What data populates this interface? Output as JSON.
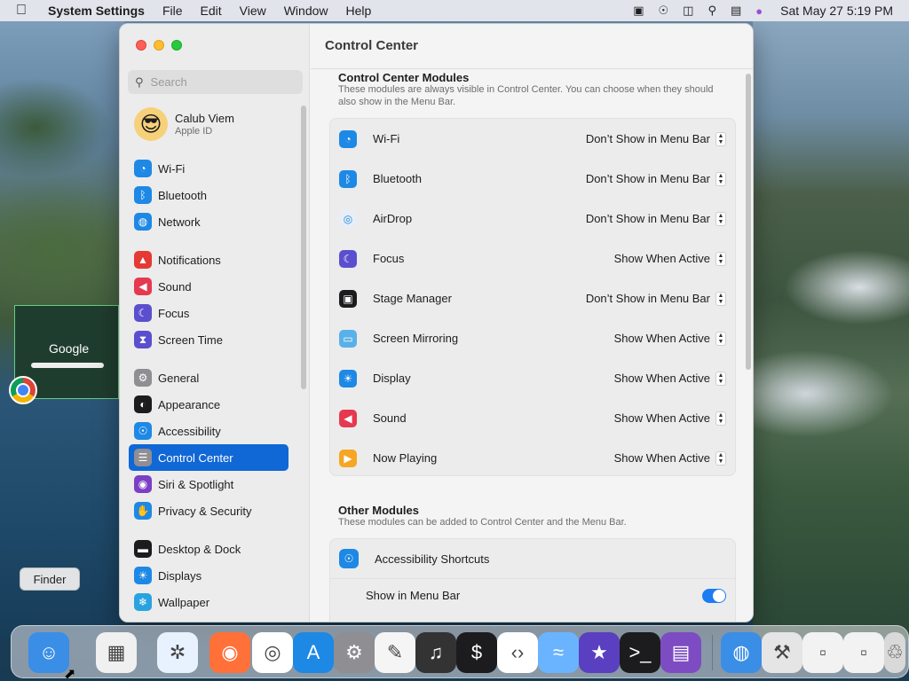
{
  "menubar": {
    "app_name": "System Settings",
    "items": [
      "File",
      "Edit",
      "View",
      "Window",
      "Help"
    ],
    "clock": "Sat May 27  5:19 PM"
  },
  "window": {
    "title": "Control Center",
    "search": {
      "placeholder": "Search",
      "value": ""
    },
    "user": {
      "name": "Calub Viem",
      "subtitle": "Apple ID"
    },
    "sidebar": {
      "groups": [
        [
          {
            "label": "Wi-Fi",
            "icon": "wifi-icon",
            "color": "#1e88e5"
          },
          {
            "label": "Bluetooth",
            "icon": "bluetooth-icon",
            "color": "#1e88e5"
          },
          {
            "label": "Network",
            "icon": "globe-icon",
            "color": "#1e88e5"
          }
        ],
        [
          {
            "label": "Notifications",
            "icon": "bell-icon",
            "color": "#e53935"
          },
          {
            "label": "Sound",
            "icon": "speaker-icon",
            "color": "#e53950"
          },
          {
            "label": "Focus",
            "icon": "moon-icon",
            "color": "#5b4fcf"
          },
          {
            "label": "Screen Time",
            "icon": "hourglass-icon",
            "color": "#5b4fcf"
          }
        ],
        [
          {
            "label": "General",
            "icon": "gear-icon",
            "color": "#8e8e93"
          },
          {
            "label": "Appearance",
            "icon": "appearance-icon",
            "color": "#1c1c1e"
          },
          {
            "label": "Accessibility",
            "icon": "accessibility-icon",
            "color": "#1e88e5"
          },
          {
            "label": "Control Center",
            "icon": "toggles-icon",
            "color": "#8e8e93",
            "active": true
          },
          {
            "label": "Siri & Spotlight",
            "icon": "siri-icon",
            "color": "#7b3fc4"
          },
          {
            "label": "Privacy & Security",
            "icon": "hand-icon",
            "color": "#1e88e5"
          }
        ],
        [
          {
            "label": "Desktop & Dock",
            "icon": "dock-icon",
            "color": "#1c1c1e"
          },
          {
            "label": "Displays",
            "icon": "display-icon",
            "color": "#1e88e5"
          },
          {
            "label": "Wallpaper",
            "icon": "wallpaper-icon",
            "color": "#29a3e0"
          }
        ]
      ]
    },
    "modules_section": {
      "title": "Control Center Modules",
      "description": "These modules are always visible in Control Center. You can choose when they should also show in the Menu Bar.",
      "rows": [
        {
          "name": "Wi-Fi",
          "value": "Don’t Show in Menu Bar",
          "icon": "wifi-icon",
          "color": "#1e88e5"
        },
        {
          "name": "Bluetooth",
          "value": "Don’t Show in Menu Bar",
          "icon": "bluetooth-icon",
          "color": "#1e88e5"
        },
        {
          "name": "AirDrop",
          "value": "Don’t Show in Menu Bar",
          "icon": "airdrop-icon",
          "color": "#e8eef5"
        },
        {
          "name": "Focus",
          "value": "Show When Active",
          "icon": "moon-icon",
          "color": "#5b4fcf"
        },
        {
          "name": "Stage Manager",
          "value": "Don’t Show in Menu Bar",
          "icon": "stage-manager-icon",
          "color": "#1c1c1e"
        },
        {
          "name": "Screen Mirroring",
          "value": "Show When Active",
          "icon": "screen-mirroring-icon",
          "color": "#5ab0e8"
        },
        {
          "name": "Display",
          "value": "Show When Active",
          "icon": "sun-icon",
          "color": "#1e88e5"
        },
        {
          "name": "Sound",
          "value": "Show When Active",
          "icon": "speaker-icon",
          "color": "#e53950"
        },
        {
          "name": "Now Playing",
          "value": "Show When Active",
          "icon": "play-icon",
          "color": "#f5a623"
        }
      ]
    },
    "other_section": {
      "title": "Other Modules",
      "description": "These modules can be added to Control Center and the Menu Bar.",
      "row_name": "Accessibility Shortcuts",
      "sub_label": "Show in Menu Bar",
      "toggle_on": true
    }
  },
  "desktop": {
    "thumbnail_text": "Google",
    "tooltip": "Finder"
  },
  "dock": [
    {
      "name": "finder-icon",
      "color": "#3a8ee6"
    },
    {
      "name": "launchpad-icon",
      "color": "#f0f0f0"
    },
    {
      "name": "safari-icon",
      "color": "#e8f2ff"
    },
    {
      "name": "firefox-icon",
      "color": "#ff7139"
    },
    {
      "name": "chrome-icon",
      "color": "#ffffff"
    },
    {
      "name": "app-store-icon",
      "color": "#1e88e5"
    },
    {
      "name": "system-settings-icon",
      "color": "#8e8e93"
    },
    {
      "name": "textedit-icon",
      "color": "#f5f5f5"
    },
    {
      "name": "garageband-icon",
      "color": "#333333"
    },
    {
      "name": "terminal-green-icon",
      "color": "#1c1c1e"
    },
    {
      "name": "vscode-icon",
      "color": "#ffffff"
    },
    {
      "name": "dolphin-icon",
      "color": "#6ab4ff"
    },
    {
      "name": "imovie-icon",
      "color": "#5a3fc0"
    },
    {
      "name": "terminal-icon",
      "color": "#1c1c1e"
    },
    {
      "name": "storage-icon",
      "color": "#7d4cc2"
    },
    {
      "name": "globe-icon",
      "color": "#3a8ee6"
    },
    {
      "name": "utility-icon",
      "color": "#e5e5e5"
    },
    {
      "name": "window-preview-icon",
      "color": "#f2f2f2"
    },
    {
      "name": "window-preview-2-icon",
      "color": "#f2f2f2"
    },
    {
      "name": "trash-icon",
      "color": "#d9d9d9"
    }
  ]
}
